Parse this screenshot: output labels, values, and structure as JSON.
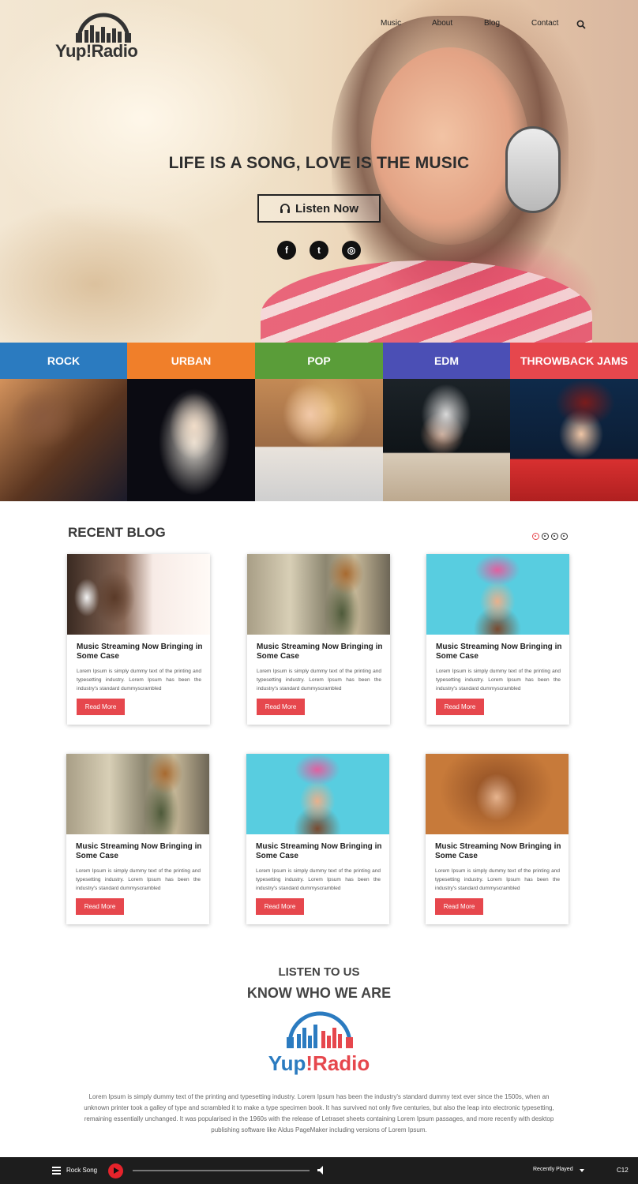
{
  "brand": {
    "name": "Yup!Radio",
    "name_part1": "Yup",
    "name_part2": "!Radio"
  },
  "nav": {
    "items": [
      "Music",
      "About",
      "Blog",
      "Contact"
    ],
    "search_icon": "search-icon"
  },
  "hero": {
    "title": "LIFE IS A SONG, LOVE IS THE MUSIC",
    "button_label": "Listen Now",
    "button_icon": "headphones-icon",
    "social": [
      {
        "name": "facebook-icon",
        "glyph": "f"
      },
      {
        "name": "twitter-icon",
        "glyph": "t"
      },
      {
        "name": "instagram-icon",
        "glyph": "◎"
      }
    ]
  },
  "genres": [
    {
      "label": "ROCK",
      "color": "#2b7bc0"
    },
    {
      "label": "URBAN",
      "color": "#f07f2a"
    },
    {
      "label": "POP",
      "color": "#5a9d39"
    },
    {
      "label": "EDM",
      "color": "#4b4fb5"
    },
    {
      "label": "THROWBACK JAMS",
      "color": "#e6474d"
    }
  ],
  "blog": {
    "section_title": "RECENT BLOG",
    "posts": [
      {
        "title": "Music Streaming Now Bringing in Some Case",
        "text": "Lorem Ipsum is simply dummy text of the printing and typesetting industry. Lorem Ipsum has been the industry's standard dummyscrambled",
        "button": "Read More"
      },
      {
        "title": "Music Streaming Now Bringing in Some Case",
        "text": "Lorem Ipsum is simply dummy text of the printing and typesetting industry. Lorem Ipsum has been the industry's standard dummyscrambled",
        "button": "Read More"
      },
      {
        "title": "Music Streaming Now Bringing in Some Case",
        "text": "Lorem Ipsum is simply dummy text of the printing and typesetting industry. Lorem Ipsum has been the industry's standard dummyscrambled",
        "button": "Read More"
      },
      {
        "title": "Music Streaming Now Bringing in Some Case",
        "text": "Lorem Ipsum is simply dummy text of the printing and typesetting industry. Lorem Ipsum has been the industry's standard dummyscrambled",
        "button": "Read More"
      },
      {
        "title": "Music Streaming Now Bringing in Some Case",
        "text": "Lorem Ipsum is simply dummy text of the printing and typesetting industry. Lorem Ipsum has been the industry's standard dummyscrambled",
        "button": "Read More"
      },
      {
        "title": "Music Streaming Now Bringing in Some Case",
        "text": "Lorem Ipsum is simply dummy text of the printing and typesetting industry. Lorem Ipsum has been the industry's standard dummyscrambled",
        "button": "Read More"
      }
    ]
  },
  "about": {
    "kicker": "LISTEN TO US",
    "title": "KNOW WHO WE ARE",
    "text": "Lorem Ipsum is simply dummy text of the printing and typesetting industry. Lorem Ipsum has been the industry's standard dummy text ever since the 1500s, when an unknown printer took a galley of type and scrambled it to make a type specimen book. It has survived not only five centuries, but also the leap into electronic typesetting, remaining essentially unchanged. It was popularised in the 1960s with the release of Letraset sheets containing Lorem Ipsum passages, and more recently with desktop publishing software like Aldus PageMaker including versions of Lorem Ipsum."
  },
  "player": {
    "track": "Rock Song",
    "recent_label": "Recently Played",
    "code": "C12",
    "progress": 0
  },
  "colors": {
    "accent": "#e6474d",
    "player_bg": "#1d1d1d",
    "logo_blue": "#2b7bc0",
    "logo_red": "#e6474d"
  }
}
